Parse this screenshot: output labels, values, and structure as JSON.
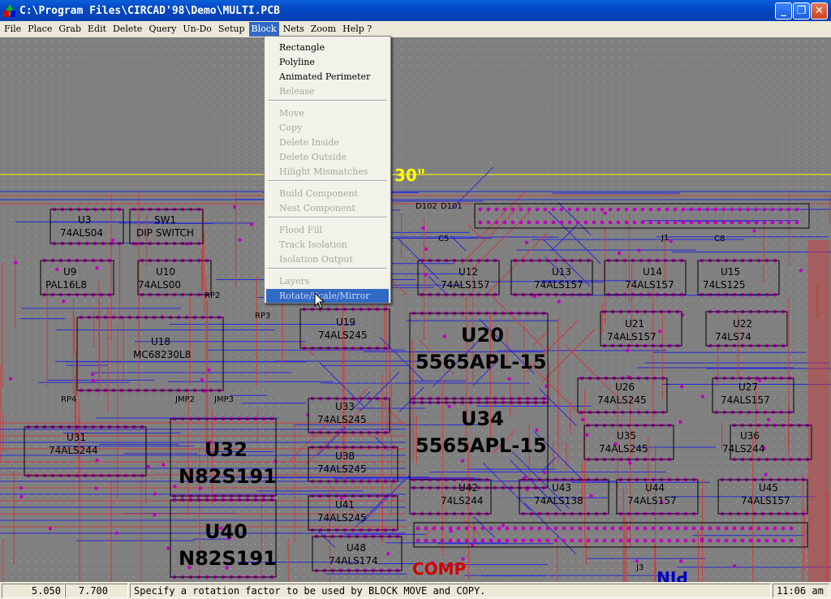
{
  "window": {
    "title": "C:\\Program Files\\CIRCAD'98\\Demo\\MULTI.PCB",
    "minimize": "_",
    "maximize": "❐",
    "close": "✕"
  },
  "menubar": {
    "items": [
      "File",
      "Place",
      "Grab",
      "Edit",
      "Delete",
      "Query",
      "Un-Do",
      "Setup",
      "Block",
      "Nets",
      "Zoom",
      "Help ?"
    ],
    "active": "Block"
  },
  "block_menu": {
    "items": [
      {
        "label": "Rectangle",
        "enabled": true
      },
      {
        "label": "Polyline",
        "enabled": true
      },
      {
        "label": "Animated Perimeter",
        "enabled": true
      },
      {
        "label": "Release",
        "enabled": false
      },
      {
        "label": "Move",
        "enabled": false
      },
      {
        "label": "Copy",
        "enabled": false
      },
      {
        "label": "Delete Inside",
        "enabled": false
      },
      {
        "label": "Delete Outside",
        "enabled": false
      },
      {
        "label": "Hilight Mismatches",
        "enabled": false
      },
      {
        "label": "Build Component",
        "enabled": false
      },
      {
        "label": "Nest Component",
        "enabled": false
      },
      {
        "label": "Flood Fill",
        "enabled": false
      },
      {
        "label": "Track Isolation",
        "enabled": false
      },
      {
        "label": "Isolation Output",
        "enabled": false
      },
      {
        "label": "Layers",
        "enabled": false
      },
      {
        "label": "Rotate/Scale/Mirror",
        "enabled": false,
        "highlighted": true
      }
    ]
  },
  "board": {
    "dimension_label": "30\"",
    "comp_label": "COMP",
    "pin_label": "PIN",
    "large_parts": [
      {
        "ref": "U20",
        "value": "5565APL-15"
      },
      {
        "ref": "U34",
        "value": "5565APL-15"
      },
      {
        "ref": "U32",
        "value": "N82S191"
      },
      {
        "ref": "U40",
        "value": "N82S191"
      }
    ],
    "parts": [
      {
        "ref": "U3",
        "value": "74ALS04"
      },
      {
        "ref": "SW1",
        "value": "DIP SWITCH"
      },
      {
        "ref": "U9",
        "value": "PAL16L8"
      },
      {
        "ref": "U10",
        "value": "74ALS00"
      },
      {
        "ref": "U18",
        "value": "MC68230L8"
      },
      {
        "ref": "U31",
        "value": "74ALS244"
      },
      {
        "ref": "U12",
        "value": "74ALS157"
      },
      {
        "ref": "U13",
        "value": "74ALS157"
      },
      {
        "ref": "U14",
        "value": "74ALS157"
      },
      {
        "ref": "U15",
        "value": "74LS125"
      },
      {
        "ref": "U19",
        "value": "74ALS245"
      },
      {
        "ref": "U21",
        "value": "74ALS157"
      },
      {
        "ref": "U22",
        "value": "74LS74"
      },
      {
        "ref": "U26",
        "value": "74ALS245"
      },
      {
        "ref": "U27",
        "value": "74ALS157"
      },
      {
        "ref": "U33",
        "value": "74ALS245"
      },
      {
        "ref": "U35",
        "value": "74ALS245"
      },
      {
        "ref": "U36",
        "value": "74LS244"
      },
      {
        "ref": "U38",
        "value": "74ALS245"
      },
      {
        "ref": "U41",
        "value": "74ALS245"
      },
      {
        "ref": "U42",
        "value": "74LS244"
      },
      {
        "ref": "U43",
        "value": "74ALS138"
      },
      {
        "ref": "U44",
        "value": "74ALS157"
      },
      {
        "ref": "U45",
        "value": "74ALS157"
      },
      {
        "ref": "U48",
        "value": "74ALS174"
      }
    ],
    "misc_labels": [
      "RP2",
      "RP3",
      "RP4",
      "JMP2",
      "JMP3",
      "D102",
      "D101",
      "J3",
      "J1",
      "C8",
      "C5"
    ]
  },
  "status": {
    "x": "5.050",
    "y": "7.700",
    "message": "Specify a rotation factor to be used by BLOCK MOVE and COPY.",
    "time": "11:06 am"
  },
  "colors": {
    "background": "#808080",
    "trace_red": "#c83c3c",
    "trace_blue": "#2828d8",
    "pad": "#c000c0",
    "silk": "#000000",
    "board_outline": "#ffff00",
    "highlight": "#316ac5"
  }
}
